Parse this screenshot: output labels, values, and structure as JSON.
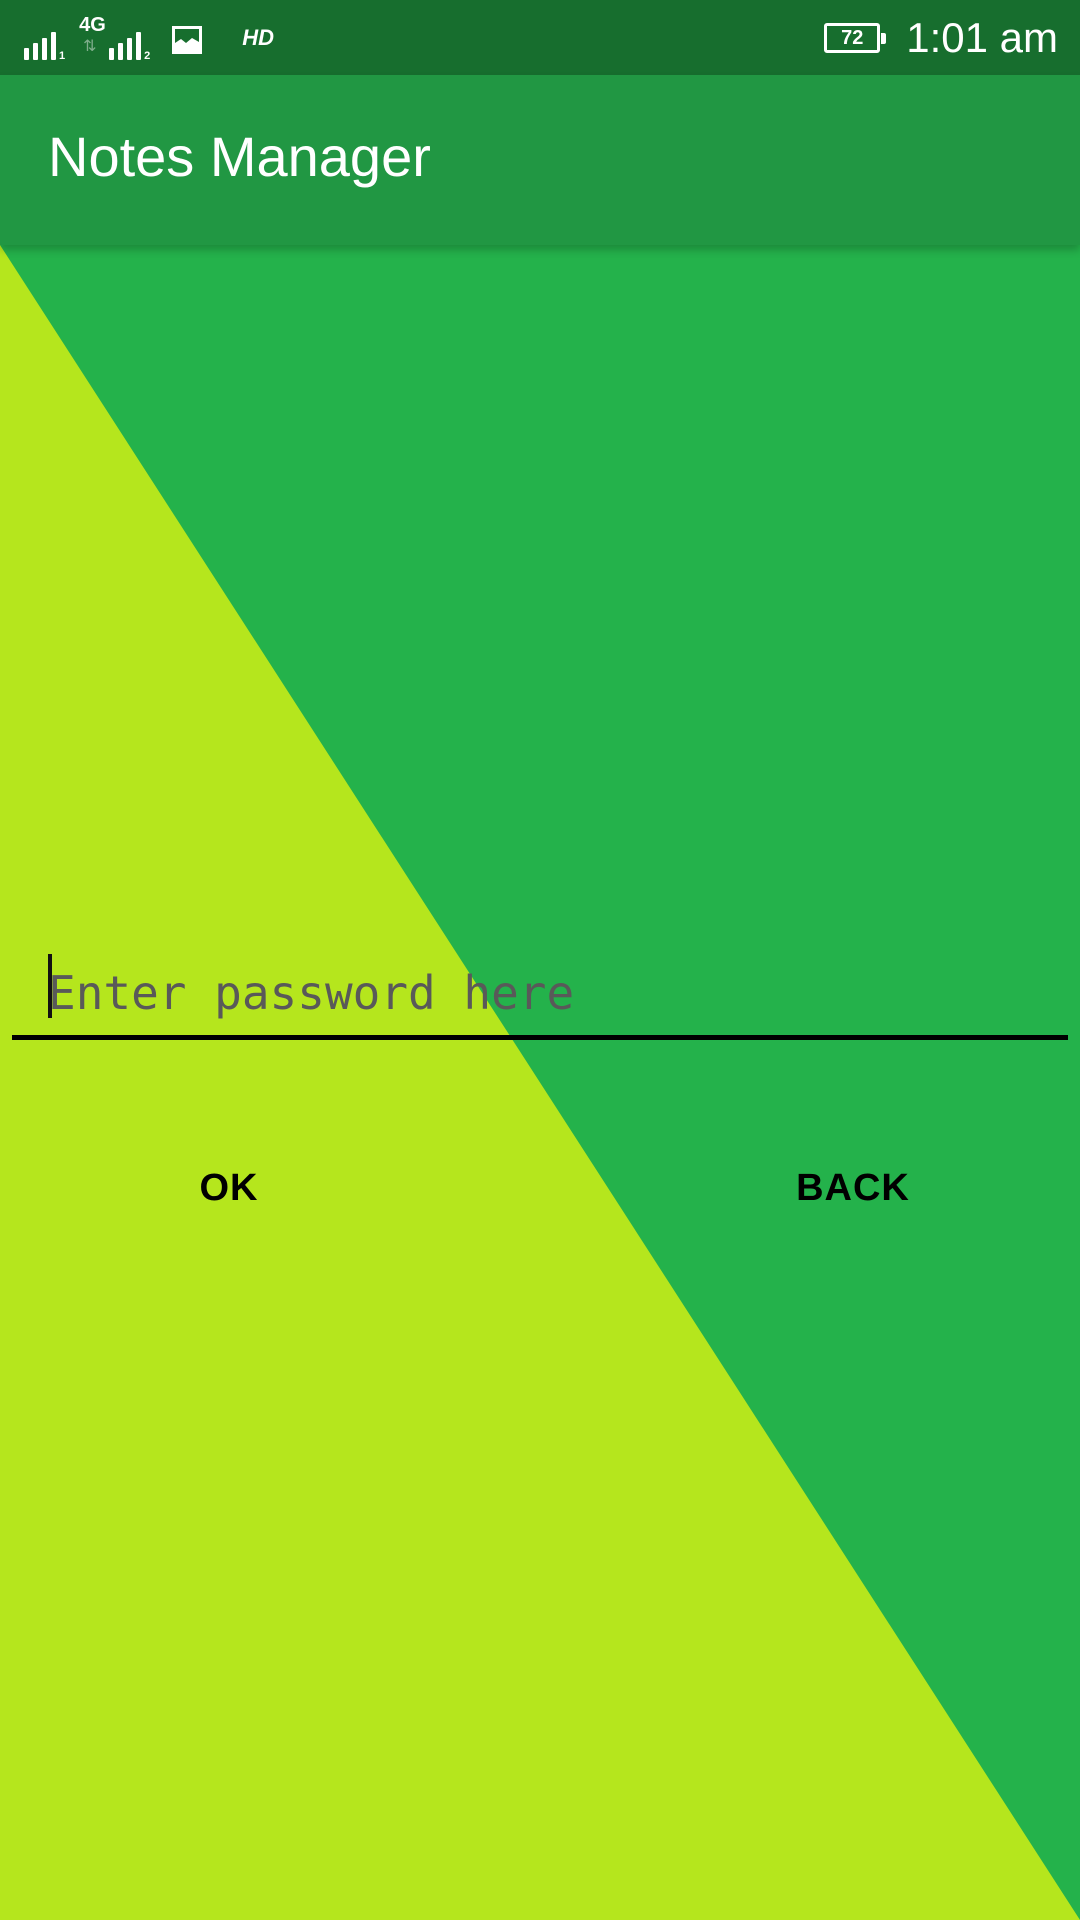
{
  "status_bar": {
    "sim1_label": "1",
    "network_type": "4G",
    "network_arrows": "⇅",
    "sim2_label": "2",
    "hd_label": "HD",
    "battery_level": "72",
    "time": "1:01 am",
    "icons": [
      "signal-sim1-icon",
      "network-4g-icon",
      "signal-sim2-icon",
      "gallery-notification-icon",
      "hd-icon",
      "battery-icon"
    ]
  },
  "app_bar": {
    "title": "Notes Manager"
  },
  "password": {
    "value": "",
    "placeholder": "Enter password here"
  },
  "buttons": {
    "ok_label": "OK",
    "back_label": "BACK"
  },
  "colors": {
    "status_bar": "#176e2e",
    "app_bar": "#219743",
    "background_green": "#24b24b",
    "background_lime": "#b5e61d",
    "text_on_primary": "#ffffff"
  }
}
